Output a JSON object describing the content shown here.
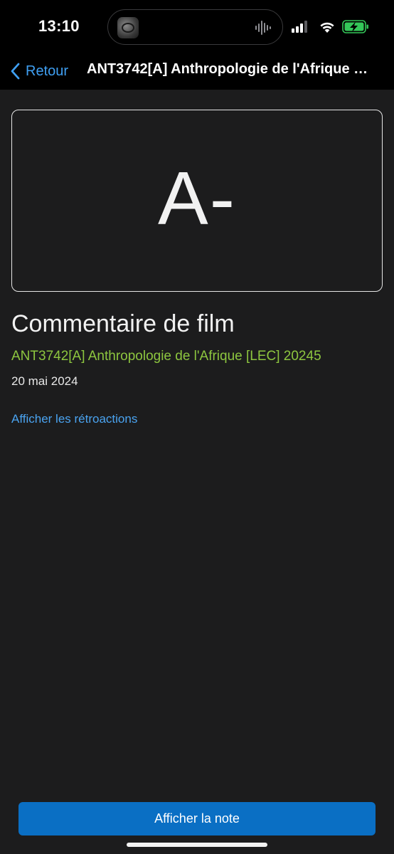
{
  "status_bar": {
    "time": "13:10",
    "icons": [
      "cellular-signal-icon",
      "wifi-icon",
      "battery-charging-icon"
    ],
    "battery_color": "#34c759"
  },
  "navbar": {
    "back_label": "Retour",
    "title": "ANT3742[A] Anthropologie de l'Afrique [LEC] 20245"
  },
  "grade": {
    "value": "A-"
  },
  "assignment": {
    "title": "Commentaire de film",
    "course": "ANT3742[A] Anthropologie de l'Afrique [LEC] 20245",
    "date": "20 mai 2024",
    "feedback_link": "Afficher les rétroactions"
  },
  "footer": {
    "button_label": "Afficher la note"
  },
  "colors": {
    "background": "#1c1c1d",
    "accent_link": "#4aa3f0",
    "course_green": "#8dc63f",
    "button_blue": "#0a6fc4"
  }
}
